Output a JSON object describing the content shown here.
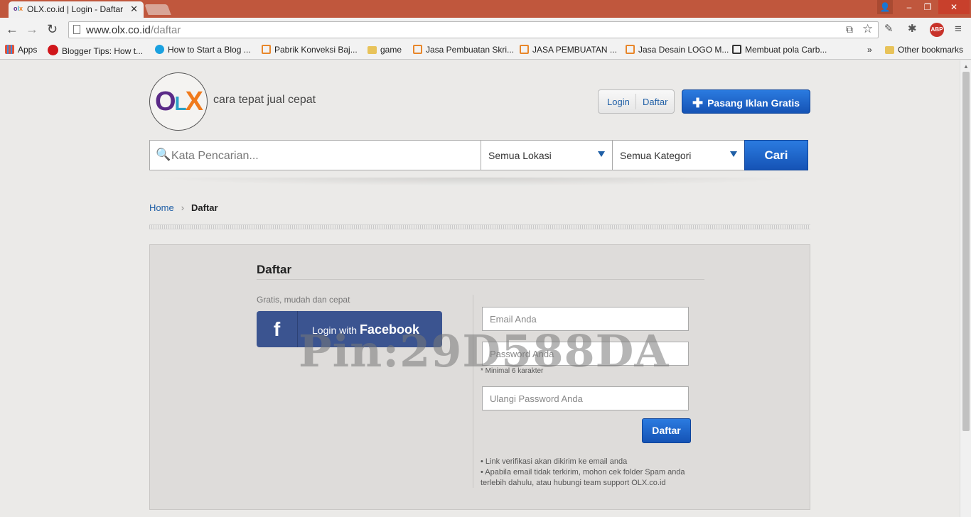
{
  "browser": {
    "tab_title": "OLX.co.id | Login - Daftar",
    "tab_favicon": "olx",
    "url_host": "www.olx.co.id",
    "url_path": "/daftar",
    "bookmarks": [
      {
        "label": "Apps",
        "icon": "apps-grid-icon",
        "color": "#e0533c"
      },
      {
        "label": "Blogger Tips: How t...",
        "icon": "red-circle-icon",
        "color": "#d0161b"
      },
      {
        "label": "How to Start a Blog ...",
        "icon": "blue-a-icon",
        "color": "#1aa1e0"
      },
      {
        "label": "Pabrik Konveksi Baj...",
        "icon": "page-icon",
        "color": "#e8862a"
      },
      {
        "label": "game",
        "icon": "folder-icon",
        "color": "#e8c35a"
      },
      {
        "label": "Jasa Pembuatan Skri...",
        "icon": "page-icon",
        "color": "#e8862a"
      },
      {
        "label": "JASA PEMBUATAN ...",
        "icon": "page-icon",
        "color": "#e8862a"
      },
      {
        "label": "Jasa Desain LOGO M...",
        "icon": "page-icon",
        "color": "#e8862a"
      },
      {
        "label": "Membuat pola Carb...",
        "icon": "logo-icon",
        "color": "#333333"
      }
    ],
    "bookmarks_overflow": "»",
    "other_bookmarks": "Other bookmarks"
  },
  "header": {
    "logo": {
      "o": "O",
      "l": "L",
      "x": "X"
    },
    "tagline": "cara tepat jual cepat",
    "login_label": "Login",
    "register_label": "Daftar",
    "post_ad_label": "Pasang Iklan Gratis"
  },
  "search": {
    "placeholder": "Kata Pencarian...",
    "location": "Semua Lokasi",
    "category": "Semua Kategori",
    "button": "Cari"
  },
  "breadcrumb": {
    "home": "Home",
    "current": "Daftar"
  },
  "register": {
    "title": "Daftar",
    "subtitle": "Gratis, mudah dan cepat",
    "facebook_prefix": "Login with",
    "facebook_brand": "Facebook",
    "email_placeholder": "Email Anda",
    "password_placeholder": "Password Anda",
    "password_note": "* Minimal 6 karakter",
    "repeat_password_placeholder": "Ulangi Password Anda",
    "submit": "Daftar",
    "info_1": "• Link verifikasi akan dikirim ke email anda",
    "info_2": "• Apabila email tidak terkirim, mohon cek folder Spam anda terlebih dahulu, atau hubungi team support OLX.co.id"
  },
  "watermark": "Pin:29D588DA",
  "colors": {
    "title_bar": "#c0573d",
    "primary_blue": "#1f5fa6",
    "facebook": "#3b5490"
  }
}
